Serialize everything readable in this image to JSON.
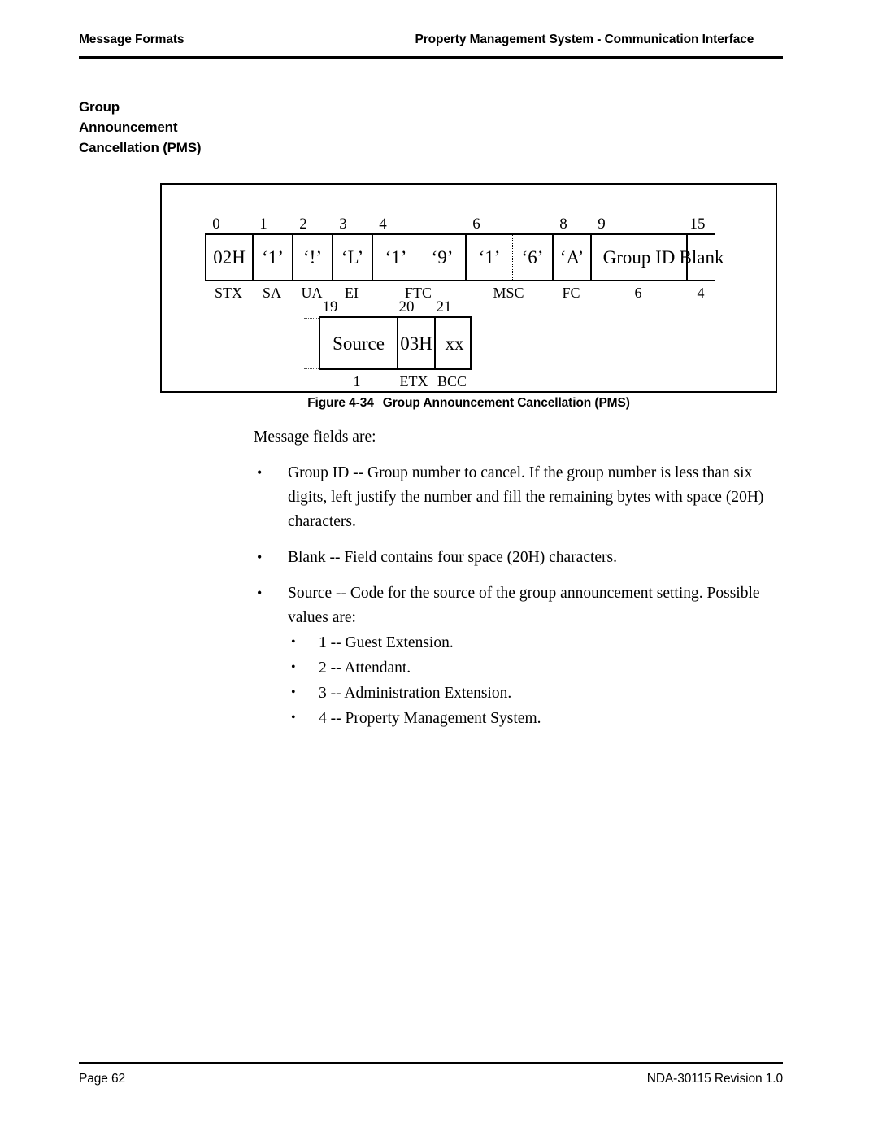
{
  "header": {
    "left": "Message Formats",
    "right": "Property Management System - Communication Interface"
  },
  "section_heading": {
    "line1": "Group",
    "line2": "Announcement",
    "line3": "Cancellation (PMS)"
  },
  "figure": {
    "caption_number": "Figure 4-34",
    "caption_text": "Group Announcement Cancellation (PMS)",
    "row1": {
      "offsets": [
        "0",
        "1",
        "2",
        "3",
        "4",
        "6",
        "8",
        "9",
        "15"
      ],
      "cells": [
        "02H",
        "‘1’",
        "‘!’",
        "‘L’",
        "‘1’",
        "‘9’",
        "‘1’",
        "‘6’",
        "‘A’",
        "Group ID",
        "Blank"
      ],
      "labels": [
        "STX",
        "SA",
        "UA",
        "EI",
        "FTC",
        "MSC",
        "FC",
        "6",
        "4"
      ]
    },
    "row2": {
      "offsets": [
        "19",
        "20",
        "21"
      ],
      "cells": [
        "Source",
        "03H",
        "xx"
      ],
      "labels": [
        "1",
        "ETX",
        "BCC"
      ]
    }
  },
  "body": {
    "intro": "Message fields are:",
    "bullets": [
      "Group ID -- Group number to cancel. If the group number is less than six digits, left justify the number and fill the remaining bytes with space (20H) characters.",
      "Blank -- Field contains four space (20H) characters.",
      "Source -- Code for the source of the group announcement setting. Possible values are:"
    ],
    "source_values": [
      "1 -- Guest Extension.",
      "2 -- Attendant.",
      "3 -- Administration Extension.",
      "4 -- Property Management System."
    ],
    "bullet_glyph": "•"
  },
  "footer": {
    "left": "Page 62",
    "right": "NDA-30115  Revision 1.0"
  }
}
